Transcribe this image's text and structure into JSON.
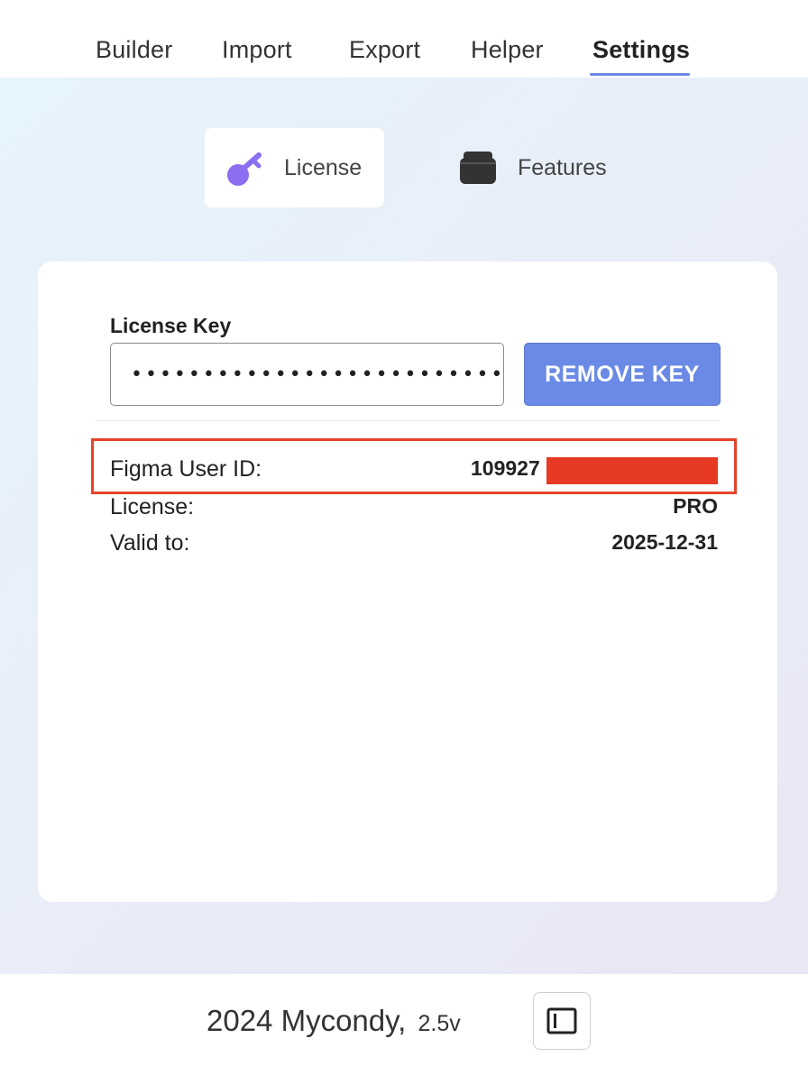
{
  "nav": {
    "tabs": [
      {
        "label": "Builder"
      },
      {
        "label": "Import"
      },
      {
        "label": "Export"
      },
      {
        "label": "Helper"
      },
      {
        "label": "Settings"
      }
    ],
    "active_tab": "Settings",
    "accent_color": "#6b8ae6"
  },
  "settings_tabs": {
    "license": {
      "label": "License",
      "icon": "key-icon",
      "icon_color": "#8b6ff0"
    },
    "features": {
      "label": "Features",
      "icon": "box-icon"
    }
  },
  "license_card": {
    "field_label": "License Key",
    "key_value_masked": "••••••••••••••••••••••••••••••",
    "remove_button": "REMOVE KEY",
    "rows": [
      {
        "key": "Figma User ID:",
        "value": "109927"
      },
      {
        "key": "License:",
        "value": "PRO"
      },
      {
        "key": "Valid to:",
        "value": "2025-12-31"
      }
    ],
    "redaction_color": "#e73a24"
  },
  "footer": {
    "copyright": "2024 Mycondy,",
    "version": "2.5v",
    "panel_icon": "sidebar-panel-icon"
  }
}
